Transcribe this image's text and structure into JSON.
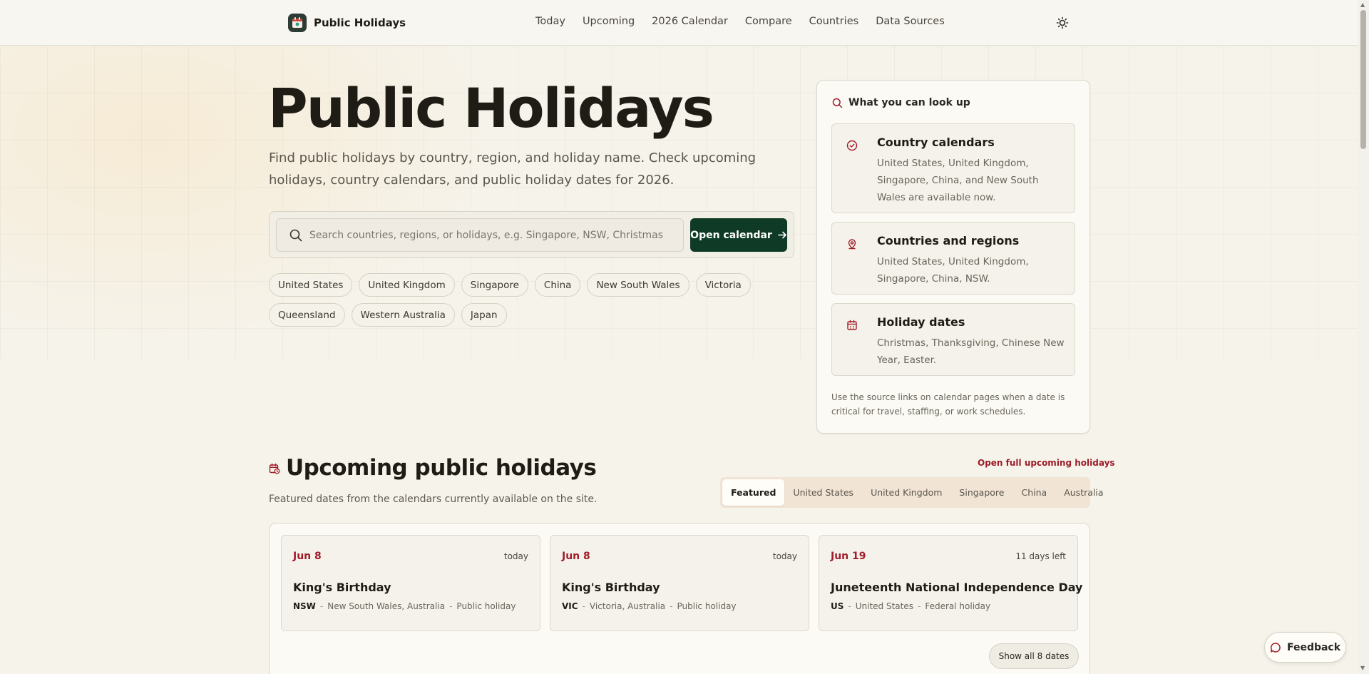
{
  "brand": {
    "name": "Public Holidays"
  },
  "nav": {
    "items": [
      "Today",
      "Upcoming",
      "2026 Calendar",
      "Compare",
      "Countries",
      "Data Sources"
    ]
  },
  "hero": {
    "title": "Public Holidays",
    "subtitle": "Find public holidays by country, region, and holiday name. Check upcoming holidays, country calendars, and public holiday dates for 2026.",
    "search_placeholder": "Search countries, regions, or holidays, e.g. Singapore, NSW, Christmas",
    "search_value": "",
    "open_button": "Open calendar",
    "chips": [
      "United States",
      "United Kingdom",
      "Singapore",
      "China",
      "New South Wales",
      "Victoria",
      "Queensland",
      "Western Australia",
      "Japan"
    ]
  },
  "lookup": {
    "heading": "What you can look up",
    "items": [
      {
        "title": "Country calendars",
        "text": "United States, United Kingdom, Singapore, China, and New South Wales are available now."
      },
      {
        "title": "Countries and regions",
        "text": "United States, United Kingdom, Singapore, China, NSW."
      },
      {
        "title": "Holiday dates",
        "text": "Christmas, Thanksgiving, Chinese New Year, Easter."
      }
    ],
    "note": "Use the source links on calendar pages when a date is critical for travel, staffing, or work schedules."
  },
  "upcoming": {
    "title": "Upcoming public holidays",
    "subtitle": "Featured dates from the calendars currently available on the site.",
    "full_link": "Open full upcoming holidays",
    "tabs": [
      "Featured",
      "United States",
      "United Kingdom",
      "Singapore",
      "China",
      "Australia"
    ],
    "active_tab": "Featured",
    "cards": [
      {
        "date": "Jun 8",
        "relative": "today",
        "name": "King's Birthday",
        "code": "NSW",
        "region": "New South Wales, Australia",
        "type": "Public holiday"
      },
      {
        "date": "Jun 8",
        "relative": "today",
        "name": "King's Birthday",
        "code": "VIC",
        "region": "Victoria, Australia",
        "type": "Public holiday"
      },
      {
        "date": "Jun 19",
        "relative": "11 days left",
        "name": "Juneteenth National Independence Day",
        "code": "US",
        "region": "United States",
        "type": "Federal holiday"
      }
    ],
    "show_all": "Show all 8 dates"
  },
  "feedback": {
    "label": "Feedback"
  },
  "colors": {
    "accent_red": "#a21c2a",
    "button_green": "#0f3a26",
    "background": "#f6f3ea"
  }
}
